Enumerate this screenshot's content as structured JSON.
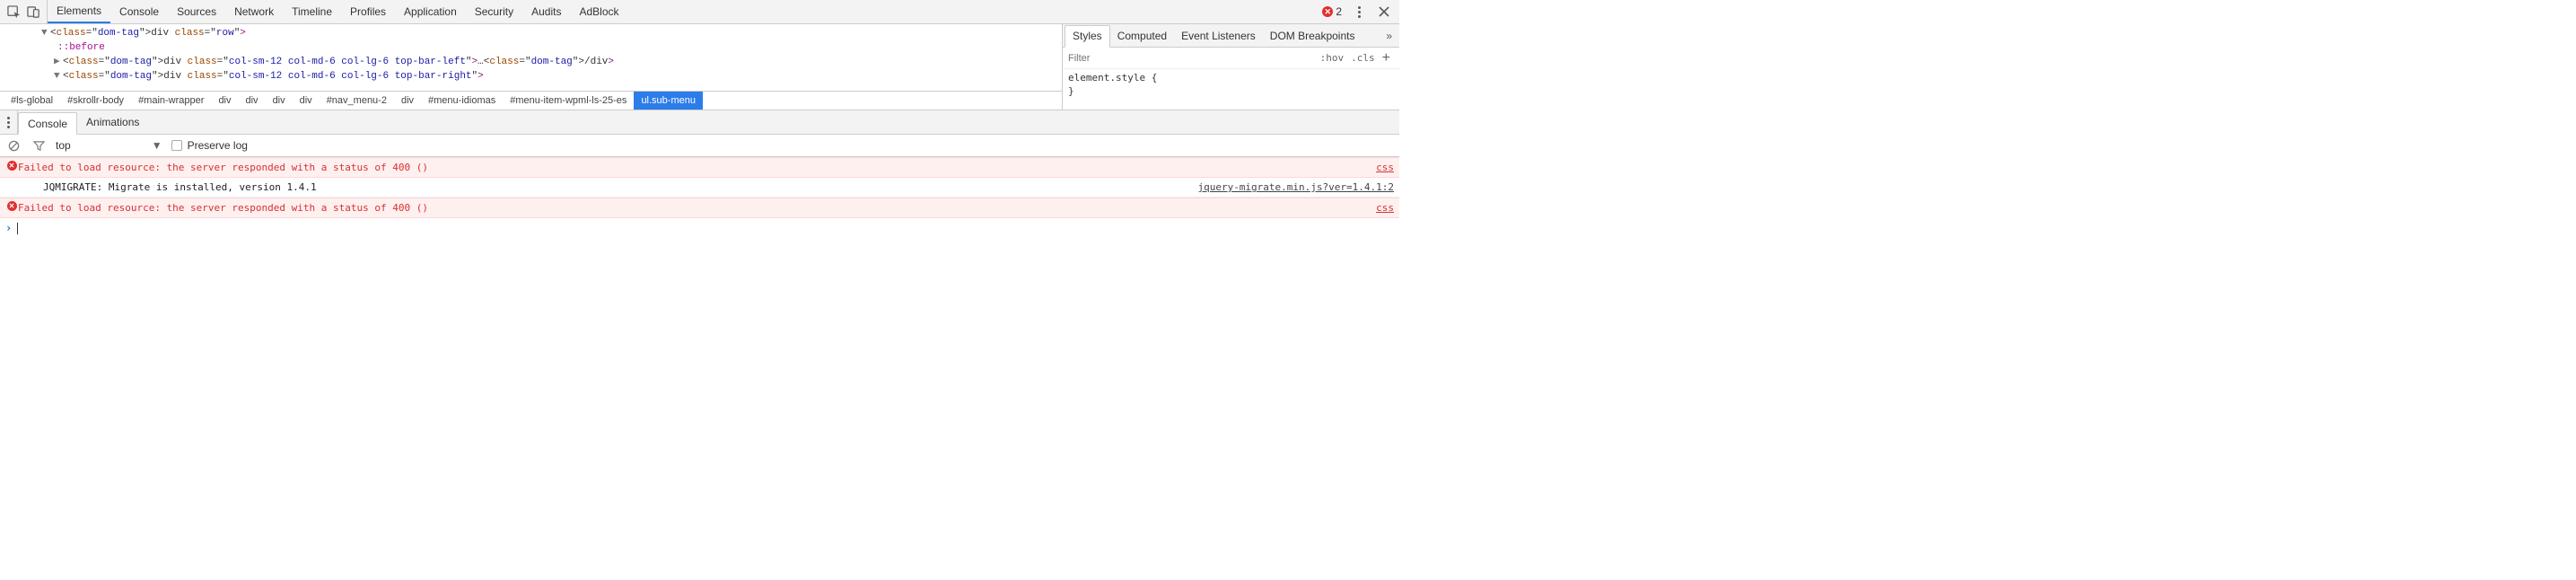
{
  "toolbar": {
    "tabs": [
      "Elements",
      "Console",
      "Sources",
      "Network",
      "Timeline",
      "Profiles",
      "Application",
      "Security",
      "Audits",
      "AdBlock"
    ],
    "active_tab": 0,
    "error_count": "2"
  },
  "dom": {
    "lines": [
      {
        "indent": 26,
        "caret": "▼",
        "html": "<div class=\"row\">"
      },
      {
        "pseudo": true,
        "text": "::before"
      },
      {
        "indent": 40,
        "caret": "▶",
        "html": "<div class=\"col-sm-12 col-md-6 col-lg-6 top-bar-left\">",
        "collapsed": "…</div>"
      },
      {
        "indent": 40,
        "caret": "▼",
        "html": "<div class=\"col-sm-12 col-md-6 col-lg-6 top-bar-right\">"
      }
    ],
    "breadcrumbs": [
      "#ls-global",
      "#skrollr-body",
      "#main-wrapper",
      "div",
      "div",
      "div",
      "div",
      "#nav_menu-2",
      "div",
      "#menu-idiomas",
      "#menu-item-wpml-ls-25-es",
      "ul.sub-menu"
    ],
    "breadcrumb_active": 11
  },
  "sidebar": {
    "tabs": [
      "Styles",
      "Computed",
      "Event Listeners",
      "DOM Breakpoints"
    ],
    "active_tab": 0,
    "filter_placeholder": "Filter",
    "badges": {
      "hov": ":hov",
      "cls": ".cls"
    },
    "style_line1": "element.style {",
    "style_line2": "}"
  },
  "drawer": {
    "tabs": [
      "Console",
      "Animations"
    ],
    "active_tab": 0
  },
  "console": {
    "context": "top",
    "preserve_label": "Preserve log",
    "messages": [
      {
        "type": "error",
        "text": "Failed to load resource: the server responded with a status of 400 ()",
        "source": "css"
      },
      {
        "type": "log",
        "text": "JQMIGRATE: Migrate is installed, version 1.4.1",
        "source": "jquery-migrate.min.js?ver=1.4.1:2"
      },
      {
        "type": "error",
        "text": "Failed to load resource: the server responded with a status of 400 ()",
        "source": "css"
      }
    ]
  }
}
